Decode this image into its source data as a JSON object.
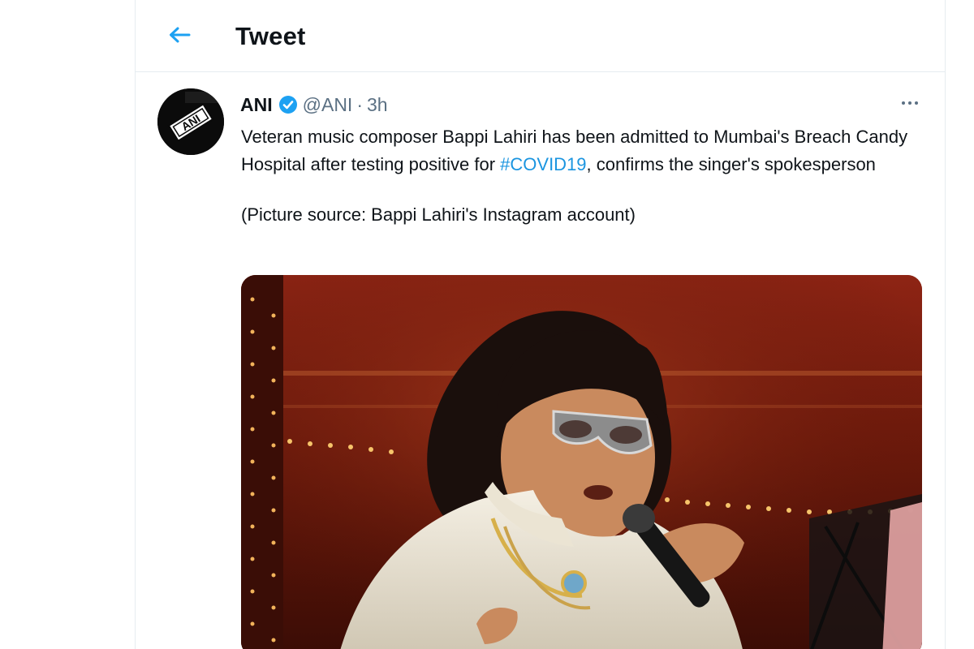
{
  "header": {
    "title": "Tweet"
  },
  "tweet": {
    "author": {
      "name": "ANI",
      "handle": "@ANI",
      "verified": true,
      "avatar_text": "ANI"
    },
    "separator": "·",
    "time": "3h",
    "text_part1": "Veteran music composer Bappi Lahiri has been admitted to Mumbai's Breach Candy Hospital after testing positive for ",
    "hashtag": "#COVID19",
    "text_part2": ", confirms the singer's spokesperson",
    "text_source": "(Picture source: Bappi Lahiri's Instagram account)"
  },
  "icons": {
    "back": "arrow-left-icon",
    "verified": "verified-badge-icon",
    "more": "more-horizontal-icon"
  },
  "colors": {
    "accent": "#1da1f2",
    "hashtag": "#1b95e0",
    "muted": "#5b7083",
    "text": "#0f1419",
    "border": "#e6ecf0"
  }
}
